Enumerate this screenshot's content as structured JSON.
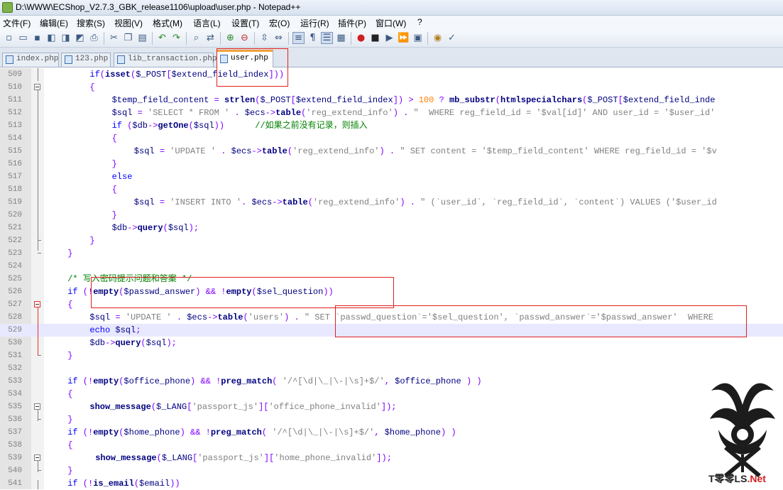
{
  "window": {
    "title": "D:\\WWW\\ECShop_V2.7.3_GBK_release1106\\upload\\user.php - Notepad++"
  },
  "menu": [
    "文件(F)",
    "编辑(E)",
    "搜索(S)",
    "视图(V)",
    "格式(M)",
    "语言(L)",
    "设置(T)",
    "宏(O)",
    "运行(R)",
    "插件(P)",
    "窗口(W)",
    "?"
  ],
  "toolbar_icons": [
    "new-file-icon",
    "open-file-icon",
    "save-icon",
    "save-all-icon",
    "close-icon",
    "close-all-icon",
    "print-icon",
    "cut-icon",
    "copy-icon",
    "paste-icon",
    "undo-icon",
    "redo-icon",
    "find-icon",
    "replace-icon",
    "zoom-in-icon",
    "zoom-out-icon",
    "sync-vertical-icon",
    "sync-horizontal-icon",
    "word-wrap-icon",
    "show-all-chars-icon",
    "indent-guide-icon",
    "user-lang-icon",
    "record-macro-icon",
    "stop-macro-icon",
    "play-macro-icon",
    "run-macro-multiple-icon",
    "save-macro-icon",
    "monitor-icon",
    "spellcheck-icon"
  ],
  "tabs": [
    {
      "label": "index.php",
      "active": false
    },
    {
      "label": "123.php",
      "active": false
    },
    {
      "label": "lib_transaction.php",
      "active": false
    },
    {
      "label": "user.php",
      "active": true
    }
  ],
  "editor": {
    "current_line": 529,
    "lines": [
      {
        "n": "509",
        "indent": 8,
        "segs": [
          [
            "kw",
            "if"
          ],
          [
            "op",
            "("
          ],
          [
            "fn",
            "isset"
          ],
          [
            "op",
            "("
          ],
          [
            "vr",
            "$_POST"
          ],
          [
            "op",
            "["
          ],
          [
            "vr",
            "$extend_field_index"
          ],
          [
            "op",
            "]))"
          ]
        ]
      },
      {
        "n": "510",
        "indent": 8,
        "segs": [
          [
            "op",
            "{"
          ]
        ]
      },
      {
        "n": "511",
        "indent": 12,
        "segs": [
          [
            "vr",
            "$temp_field_content"
          ],
          [
            "pl",
            " "
          ],
          [
            "op",
            "="
          ],
          [
            "pl",
            " "
          ],
          [
            "fn",
            "strlen"
          ],
          [
            "op",
            "("
          ],
          [
            "vr",
            "$_POST"
          ],
          [
            "op",
            "["
          ],
          [
            "vr",
            "$extend_field_index"
          ],
          [
            "op",
            "])"
          ],
          [
            "pl",
            " "
          ],
          [
            "op",
            ">"
          ],
          [
            "pl",
            " "
          ],
          [
            "nm",
            "100"
          ],
          [
            "pl",
            " "
          ],
          [
            "op",
            "?"
          ],
          [
            "pl",
            " "
          ],
          [
            "fn",
            "mb_substr"
          ],
          [
            "op",
            "("
          ],
          [
            "fn",
            "htmlspecialchars"
          ],
          [
            "op",
            "("
          ],
          [
            "vr",
            "$_POST"
          ],
          [
            "op",
            "["
          ],
          [
            "vr",
            "$extend_field_inde"
          ]
        ]
      },
      {
        "n": "512",
        "indent": 12,
        "segs": [
          [
            "vr",
            "$sql"
          ],
          [
            "pl",
            " "
          ],
          [
            "op",
            "="
          ],
          [
            "pl",
            " "
          ],
          [
            "st",
            "'SELECT * FROM '"
          ],
          [
            "pl",
            " "
          ],
          [
            "op",
            "."
          ],
          [
            "pl",
            " "
          ],
          [
            "vr",
            "$ecs"
          ],
          [
            "op",
            "->"
          ],
          [
            "fn",
            "table"
          ],
          [
            "op",
            "("
          ],
          [
            "st",
            "'reg_extend_info'"
          ],
          [
            "op",
            ")"
          ],
          [
            "pl",
            " "
          ],
          [
            "op",
            "."
          ],
          [
            "pl",
            " "
          ],
          [
            "st",
            "\"  WHERE reg_field_id = '$val[id]' AND user_id = '$user_id'"
          ]
        ]
      },
      {
        "n": "513",
        "indent": 12,
        "segs": [
          [
            "kw",
            "if"
          ],
          [
            "pl",
            " "
          ],
          [
            "op",
            "("
          ],
          [
            "vr",
            "$db"
          ],
          [
            "op",
            "->"
          ],
          [
            "fn",
            "getOne"
          ],
          [
            "op",
            "("
          ],
          [
            "vr",
            "$sql"
          ],
          [
            "op",
            "))"
          ],
          [
            "pl",
            "      "
          ],
          [
            "cm",
            "//如果之前没有记录，则插入"
          ]
        ]
      },
      {
        "n": "514",
        "indent": 12,
        "segs": [
          [
            "op",
            "{"
          ]
        ]
      },
      {
        "n": "515",
        "indent": 16,
        "segs": [
          [
            "vr",
            "$sql"
          ],
          [
            "pl",
            " "
          ],
          [
            "op",
            "="
          ],
          [
            "pl",
            " "
          ],
          [
            "st",
            "'UPDATE '"
          ],
          [
            "pl",
            " "
          ],
          [
            "op",
            "."
          ],
          [
            "pl",
            " "
          ],
          [
            "vr",
            "$ecs"
          ],
          [
            "op",
            "->"
          ],
          [
            "fn",
            "table"
          ],
          [
            "op",
            "("
          ],
          [
            "st",
            "'reg_extend_info'"
          ],
          [
            "op",
            ")"
          ],
          [
            "pl",
            " "
          ],
          [
            "op",
            "."
          ],
          [
            "pl",
            " "
          ],
          [
            "st",
            "\" SET content = '$temp_field_content' WHERE reg_field_id = '$v"
          ]
        ]
      },
      {
        "n": "516",
        "indent": 12,
        "segs": [
          [
            "op",
            "}"
          ]
        ]
      },
      {
        "n": "517",
        "indent": 12,
        "segs": [
          [
            "kw",
            "else"
          ]
        ]
      },
      {
        "n": "518",
        "indent": 12,
        "segs": [
          [
            "op",
            "{"
          ]
        ]
      },
      {
        "n": "519",
        "indent": 16,
        "segs": [
          [
            "vr",
            "$sql"
          ],
          [
            "pl",
            " "
          ],
          [
            "op",
            "="
          ],
          [
            "pl",
            " "
          ],
          [
            "st",
            "'INSERT INTO '"
          ],
          [
            "op",
            "."
          ],
          [
            "pl",
            " "
          ],
          [
            "vr",
            "$ecs"
          ],
          [
            "op",
            "->"
          ],
          [
            "fn",
            "table"
          ],
          [
            "op",
            "("
          ],
          [
            "st",
            "'reg_extend_info'"
          ],
          [
            "op",
            ")"
          ],
          [
            "pl",
            " "
          ],
          [
            "op",
            "."
          ],
          [
            "pl",
            " "
          ],
          [
            "st",
            "\" (`user_id`, `reg_field_id`, `content`) VALUES ('$user_id"
          ]
        ]
      },
      {
        "n": "520",
        "indent": 12,
        "segs": [
          [
            "op",
            "}"
          ]
        ]
      },
      {
        "n": "521",
        "indent": 12,
        "segs": [
          [
            "vr",
            "$db"
          ],
          [
            "op",
            "->"
          ],
          [
            "fn",
            "query"
          ],
          [
            "op",
            "("
          ],
          [
            "vr",
            "$sql"
          ],
          [
            "op",
            ");"
          ]
        ]
      },
      {
        "n": "522",
        "indent": 8,
        "segs": [
          [
            "op",
            "}"
          ]
        ]
      },
      {
        "n": "523",
        "indent": 4,
        "segs": [
          [
            "op",
            "}"
          ]
        ]
      },
      {
        "n": "524",
        "indent": 0,
        "segs": []
      },
      {
        "n": "525",
        "indent": 4,
        "segs": [
          [
            "cm",
            "/* 写入密码提示问题和答案 */"
          ]
        ]
      },
      {
        "n": "526",
        "indent": 4,
        "segs": [
          [
            "kw",
            "if"
          ],
          [
            "pl",
            " "
          ],
          [
            "op",
            "(!"
          ],
          [
            "fn",
            "empty"
          ],
          [
            "op",
            "("
          ],
          [
            "vr",
            "$passwd_answer"
          ],
          [
            "op",
            ")"
          ],
          [
            "pl",
            " "
          ],
          [
            "op",
            "&&"
          ],
          [
            "pl",
            " "
          ],
          [
            "op",
            "!"
          ],
          [
            "fn",
            "empty"
          ],
          [
            "op",
            "("
          ],
          [
            "vr",
            "$sel_question"
          ],
          [
            "op",
            "))"
          ]
        ]
      },
      {
        "n": "527",
        "indent": 4,
        "segs": [
          [
            "op",
            "{"
          ]
        ]
      },
      {
        "n": "528",
        "indent": 8,
        "segs": [
          [
            "vr",
            "$sql"
          ],
          [
            "pl",
            " "
          ],
          [
            "op",
            "="
          ],
          [
            "pl",
            " "
          ],
          [
            "st",
            "'UPDATE '"
          ],
          [
            "pl",
            " "
          ],
          [
            "op",
            "."
          ],
          [
            "pl",
            " "
          ],
          [
            "vr",
            "$ecs"
          ],
          [
            "op",
            "->"
          ],
          [
            "fn",
            "table"
          ],
          [
            "op",
            "("
          ],
          [
            "st",
            "'users'"
          ],
          [
            "op",
            ")"
          ],
          [
            "pl",
            " "
          ],
          [
            "op",
            "."
          ],
          [
            "pl",
            " "
          ],
          [
            "st",
            "\" SET `passwd_question`='$sel_question', `passwd_answer`='$passwd_answer'  WHERE"
          ]
        ]
      },
      {
        "n": "529",
        "indent": 8,
        "segs": [
          [
            "kw",
            "echo"
          ],
          [
            "pl",
            " "
          ],
          [
            "vr",
            "$sql"
          ],
          [
            "op",
            ";"
          ]
        ]
      },
      {
        "n": "530",
        "indent": 8,
        "segs": [
          [
            "vr",
            "$db"
          ],
          [
            "op",
            "->"
          ],
          [
            "fn",
            "query"
          ],
          [
            "op",
            "("
          ],
          [
            "vr",
            "$sql"
          ],
          [
            "op",
            ");"
          ]
        ]
      },
      {
        "n": "531",
        "indent": 4,
        "segs": [
          [
            "op",
            "}"
          ]
        ]
      },
      {
        "n": "532",
        "indent": 0,
        "segs": []
      },
      {
        "n": "533",
        "indent": 4,
        "segs": [
          [
            "kw",
            "if"
          ],
          [
            "pl",
            " "
          ],
          [
            "op",
            "(!"
          ],
          [
            "fn",
            "empty"
          ],
          [
            "op",
            "("
          ],
          [
            "vr",
            "$office_phone"
          ],
          [
            "op",
            ")"
          ],
          [
            "pl",
            " "
          ],
          [
            "op",
            "&&"
          ],
          [
            "pl",
            " "
          ],
          [
            "op",
            "!"
          ],
          [
            "fn",
            "preg_match"
          ],
          [
            "op",
            "("
          ],
          [
            "pl",
            " "
          ],
          [
            "st",
            "'/^[\\d|\\_|\\-|\\s]+$/'"
          ],
          [
            "op",
            ","
          ],
          [
            "pl",
            " "
          ],
          [
            "vr",
            "$office_phone"
          ],
          [
            "pl",
            " "
          ],
          [
            "op",
            ")"
          ],
          [
            "pl",
            " "
          ],
          [
            "op",
            ")"
          ]
        ]
      },
      {
        "n": "534",
        "indent": 4,
        "segs": [
          [
            "op",
            "{"
          ]
        ]
      },
      {
        "n": "535",
        "indent": 8,
        "segs": [
          [
            "fn",
            "show_message"
          ],
          [
            "op",
            "("
          ],
          [
            "vr",
            "$_LANG"
          ],
          [
            "op",
            "["
          ],
          [
            "st",
            "'passport_js'"
          ],
          [
            "op",
            "]["
          ],
          [
            "st",
            "'office_phone_invalid'"
          ],
          [
            "op",
            "]);"
          ]
        ]
      },
      {
        "n": "536",
        "indent": 4,
        "segs": [
          [
            "op",
            "}"
          ]
        ]
      },
      {
        "n": "537",
        "indent": 4,
        "segs": [
          [
            "kw",
            "if"
          ],
          [
            "pl",
            " "
          ],
          [
            "op",
            "(!"
          ],
          [
            "fn",
            "empty"
          ],
          [
            "op",
            "("
          ],
          [
            "vr",
            "$home_phone"
          ],
          [
            "op",
            ")"
          ],
          [
            "pl",
            " "
          ],
          [
            "op",
            "&&"
          ],
          [
            "pl",
            " "
          ],
          [
            "op",
            "!"
          ],
          [
            "fn",
            "preg_match"
          ],
          [
            "op",
            "("
          ],
          [
            "pl",
            " "
          ],
          [
            "st",
            "'/^[\\d|\\_|\\-|\\s]+$/'"
          ],
          [
            "op",
            ","
          ],
          [
            "pl",
            " "
          ],
          [
            "vr",
            "$home_phone"
          ],
          [
            "op",
            ")"
          ],
          [
            "pl",
            " "
          ],
          [
            "op",
            ")"
          ]
        ]
      },
      {
        "n": "538",
        "indent": 4,
        "segs": [
          [
            "op",
            "{"
          ]
        ]
      },
      {
        "n": "539",
        "indent": 9,
        "segs": [
          [
            "fn",
            "show_message"
          ],
          [
            "op",
            "("
          ],
          [
            "vr",
            "$_LANG"
          ],
          [
            "op",
            "["
          ],
          [
            "st",
            "'passport_js'"
          ],
          [
            "op",
            "]["
          ],
          [
            "st",
            "'home_phone_invalid'"
          ],
          [
            "op",
            "]);"
          ]
        ]
      },
      {
        "n": "540",
        "indent": 4,
        "segs": [
          [
            "op",
            "}"
          ]
        ]
      },
      {
        "n": "541",
        "indent": 4,
        "segs": [
          [
            "kw",
            "if"
          ],
          [
            "pl",
            " "
          ],
          [
            "op",
            "(!"
          ],
          [
            "fn",
            "is_email"
          ],
          [
            "op",
            "("
          ],
          [
            "vr",
            "$email"
          ],
          [
            "op",
            "))"
          ]
        ]
      }
    ]
  },
  "watermark": {
    "text": "T零零LS",
    "suffix": ".Net"
  }
}
